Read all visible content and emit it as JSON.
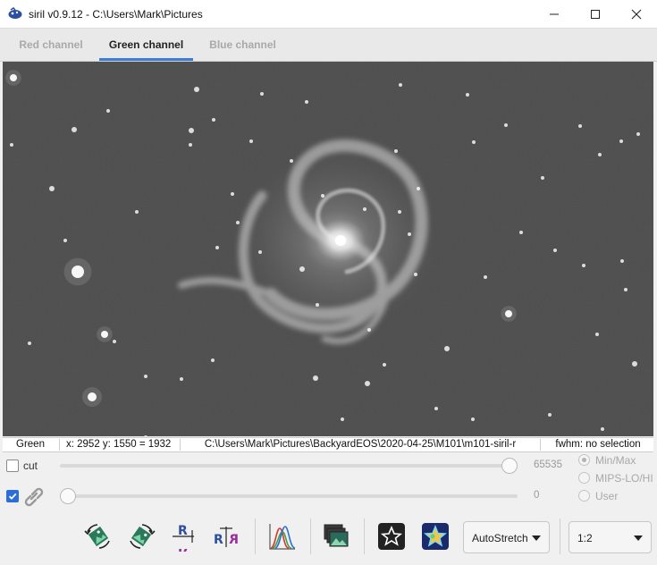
{
  "window": {
    "title": "siril v0.9.12 - C:\\Users\\Mark\\Pictures",
    "app_icon": "siril-logo-icon"
  },
  "tabs": [
    {
      "label": "Red channel",
      "active": false
    },
    {
      "label": "Green channel",
      "active": true
    },
    {
      "label": "Blue channel",
      "active": false
    }
  ],
  "viewer": {
    "content": "galaxy-image",
    "background_color": "#2e2e2e"
  },
  "status": {
    "channel": "Green",
    "coords": "x: 2952 y: 1550 = 1932",
    "path": "C:\\Users\\Mark\\Pictures\\BackyardEOS\\2020-04-25\\M101\\m101-siril-r",
    "fwhm": "fwhm: no selection"
  },
  "controls": {
    "cut_label": "cut",
    "cut_checked": false,
    "link_checked": true,
    "high_value": "65535",
    "low_value": "0",
    "high_fraction": 1.0,
    "low_fraction": 0.0,
    "scale_options": [
      {
        "label": "Min/Max",
        "selected": true
      },
      {
        "label": "MIPS-LO/HI",
        "selected": false
      },
      {
        "label": "User",
        "selected": false
      }
    ]
  },
  "toolbar": {
    "buttons": [
      {
        "icon": "rotate-left-icon"
      },
      {
        "icon": "rotate-right-icon"
      },
      {
        "icon": "mirror-x-icon"
      },
      {
        "icon": "mirror-y-icon"
      },
      {
        "icon": "histogram-icon"
      },
      {
        "icon": "image-stack-icon"
      },
      {
        "icon": "star-outline-icon"
      },
      {
        "icon": "star-color-icon"
      }
    ],
    "stretch_label": "AutoStretch",
    "zoom_label": "1:2"
  },
  "colors": {
    "accent": "#3d7bd9",
    "checkbox_checked": "#2b6fd6"
  }
}
